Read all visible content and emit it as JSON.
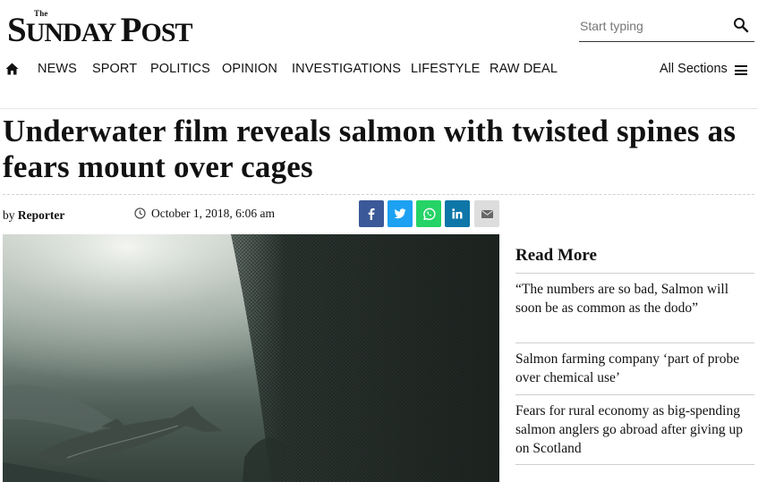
{
  "masthead": {
    "the": "The",
    "name_s": "S",
    "name_rest": "UNDAY ",
    "name_p": "P",
    "name_end": "OST"
  },
  "search": {
    "placeholder": "Start typing",
    "icon": "search-icon"
  },
  "nav": {
    "home_icon": "home-icon",
    "items": [
      "NEWS",
      "SPORT",
      "POLITICS",
      "OPINION",
      "INVESTIGATIONS",
      "LIFESTYLE",
      "RAW DEAL"
    ],
    "all_sections": "All Sections",
    "menu_icon": "hamburger-menu-icon"
  },
  "article": {
    "headline": "Underwater film reveals salmon with twisted spines as fears mount over cages",
    "by_prefix": "by",
    "author": "Reporter",
    "date": "October 1, 2018, 6:06 am",
    "clock_icon": "clock-icon"
  },
  "share": [
    {
      "icon": "facebook-icon",
      "color": "#3b5998"
    },
    {
      "icon": "twitter-icon",
      "color": "#1da1f2"
    },
    {
      "icon": "whatsapp-icon",
      "color": "#25d366"
    },
    {
      "icon": "linkedin-icon",
      "color": "#0e76a8"
    },
    {
      "icon": "email-icon",
      "color": "#dddddd"
    }
  ],
  "sidebar": {
    "title": "Read More",
    "links": [
      "“The numbers are so bad, Salmon will soon be as common as the dodo”",
      "Salmon farming company ‘part of probe over chemical use’",
      "Fears for rural economy as big-spending salmon anglers go abroad after giving up on Scotland"
    ]
  }
}
